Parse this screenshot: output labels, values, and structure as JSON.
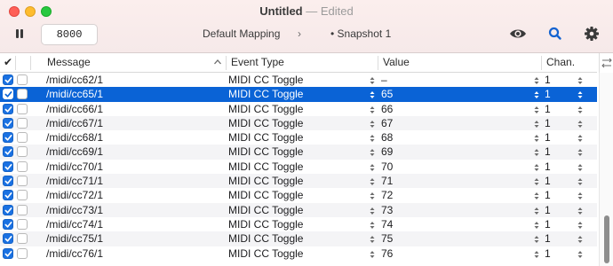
{
  "window": {
    "title": "Untitled",
    "separator": "—",
    "status": "Edited"
  },
  "toolbar": {
    "port_value": "8000",
    "mapping_label": "Default Mapping",
    "chevron": "›",
    "snapshot_label": "• Snapshot 1",
    "icons": [
      "pause-icon",
      "eye-icon",
      "search-icon",
      "gear-icon"
    ]
  },
  "table": {
    "columns": {
      "check": "✔",
      "message": "Message",
      "event_type": "Event Type",
      "value": "Value",
      "channel": "Chan."
    },
    "rows": [
      {
        "enabled": true,
        "message": "/midi/cc62/1",
        "event_type": "MIDI CC Toggle",
        "value": "–",
        "channel": "1",
        "selected": false
      },
      {
        "enabled": true,
        "message": "/midi/cc65/1",
        "event_type": "MIDI CC Toggle",
        "value": "65",
        "channel": "1",
        "selected": true
      },
      {
        "enabled": true,
        "message": "/midi/cc66/1",
        "event_type": "MIDI CC Toggle",
        "value": "66",
        "channel": "1",
        "selected": false
      },
      {
        "enabled": true,
        "message": "/midi/cc67/1",
        "event_type": "MIDI CC Toggle",
        "value": "67",
        "channel": "1",
        "selected": false
      },
      {
        "enabled": true,
        "message": "/midi/cc68/1",
        "event_type": "MIDI CC Toggle",
        "value": "68",
        "channel": "1",
        "selected": false
      },
      {
        "enabled": true,
        "message": "/midi/cc69/1",
        "event_type": "MIDI CC Toggle",
        "value": "69",
        "channel": "1",
        "selected": false
      },
      {
        "enabled": true,
        "message": "/midi/cc70/1",
        "event_type": "MIDI CC Toggle",
        "value": "70",
        "channel": "1",
        "selected": false
      },
      {
        "enabled": true,
        "message": "/midi/cc71/1",
        "event_type": "MIDI CC Toggle",
        "value": "71",
        "channel": "1",
        "selected": false
      },
      {
        "enabled": true,
        "message": "/midi/cc72/1",
        "event_type": "MIDI CC Toggle",
        "value": "72",
        "channel": "1",
        "selected": false
      },
      {
        "enabled": true,
        "message": "/midi/cc73/1",
        "event_type": "MIDI CC Toggle",
        "value": "73",
        "channel": "1",
        "selected": false
      },
      {
        "enabled": true,
        "message": "/midi/cc74/1",
        "event_type": "MIDI CC Toggle",
        "value": "74",
        "channel": "1",
        "selected": false
      },
      {
        "enabled": true,
        "message": "/midi/cc75/1",
        "event_type": "MIDI CC Toggle",
        "value": "75",
        "channel": "1",
        "selected": false
      },
      {
        "enabled": true,
        "message": "/midi/cc76/1",
        "event_type": "MIDI CC Toggle",
        "value": "76",
        "channel": "1",
        "selected": false
      }
    ]
  },
  "colors": {
    "selection": "#0a63d6",
    "checkbox_on": "#1a71e2",
    "close": "#fe5f57",
    "minimize": "#febc2e",
    "maximize": "#28c840",
    "accent_icon": "#1463d0"
  }
}
